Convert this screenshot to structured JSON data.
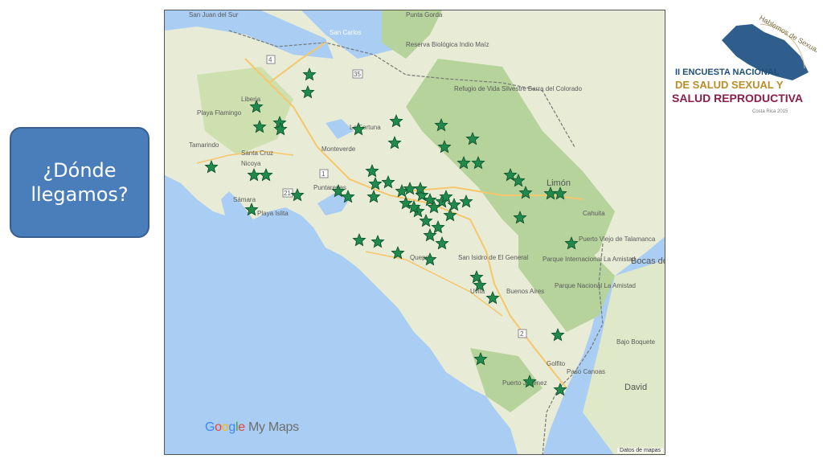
{
  "callout": {
    "line1": "¿Dónde",
    "line2": "llegamos?"
  },
  "map": {
    "brand_google": [
      "G",
      "o",
      "o",
      "g",
      "l",
      "e"
    ],
    "brand_suffix": " My Maps",
    "attribution": "Datos de mapas",
    "place_labels": [
      "San Juan del Sur",
      "Punta Gorda",
      "Reserva Biológica Indio Maíz",
      "Refugio de Vida Silvestre Barra del Colorado",
      "San Carlos",
      "Liberia",
      "Playa Flamingo",
      "Tamarindo",
      "La Fortuna",
      "Santa Cruz",
      "Nicoya",
      "Monteverde",
      "Puntarenas",
      "Sámara",
      "Playa Islita",
      "Limón",
      "Cahuita",
      "Puerto Viejo de Talamanca",
      "Bocas del",
      "Parque Internacional La Amistad",
      "Parque Nacional La Amistad",
      "San Isidro de El General",
      "Quepos",
      "Buenos Aires",
      "Uvita",
      "Golfito",
      "Paso Canoas",
      "Puerto Jiménez",
      "David",
      "Bajo Boquete"
    ],
    "road_numbers": [
      "4",
      "35",
      "1",
      "21",
      "2"
    ],
    "colors": {
      "water": "#a9cdf3",
      "land": "#e8ecd6",
      "forest": "#b5d39b",
      "marker": "#1f8a4c"
    }
  },
  "logo": {
    "arc_text": "Hablemos de Sexualidad",
    "line1": "II ENCUESTA NACIONAL",
    "line2": "DE SALUD SEXUAL Y",
    "line3": "SALUD REPRODUCTIVA",
    "footer": "Costa Rica 2015"
  }
}
